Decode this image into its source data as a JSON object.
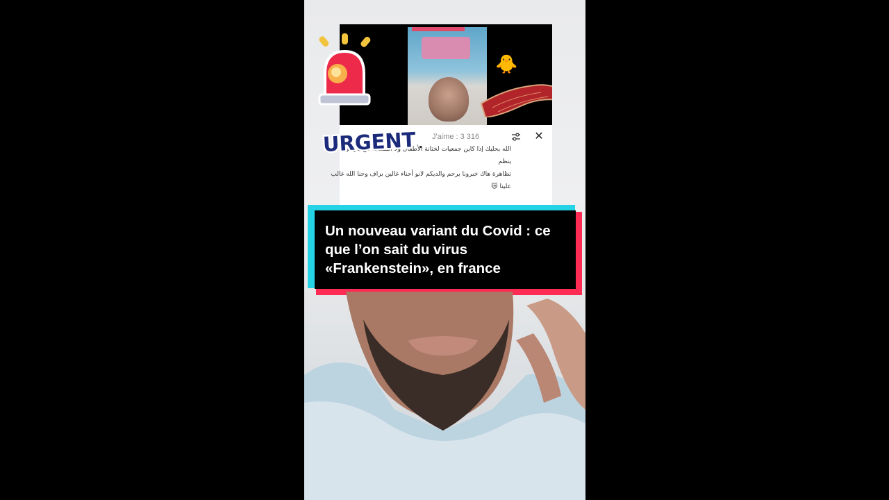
{
  "card": {
    "likes": "J'aime : 3 316",
    "comment_lines": [
      "الله يحليك إذا كاين جمعيات لختانة الأطفال ولا المسجد تاع باريس ينظم",
      "تظاهرة هاك خبرونا يرحم والديكم لانو أحناء غالين بزاف وحنا الله غالب",
      "علينا 😿"
    ]
  },
  "sticker": {
    "urgent_label": "URGENT"
  },
  "headline": {
    "text": "Un nouveau variant du Covid : ce que l’on sait du virus «Frankenstein», en france"
  },
  "icons": {
    "filter": "sliders-icon",
    "close": "close-icon",
    "siren": "siren-icon",
    "chick": "chick-icon"
  },
  "colors": {
    "banner_cyan": "#25d3e6",
    "banner_red": "#fe2c55",
    "urgent_text": "#1b2a7a"
  }
}
